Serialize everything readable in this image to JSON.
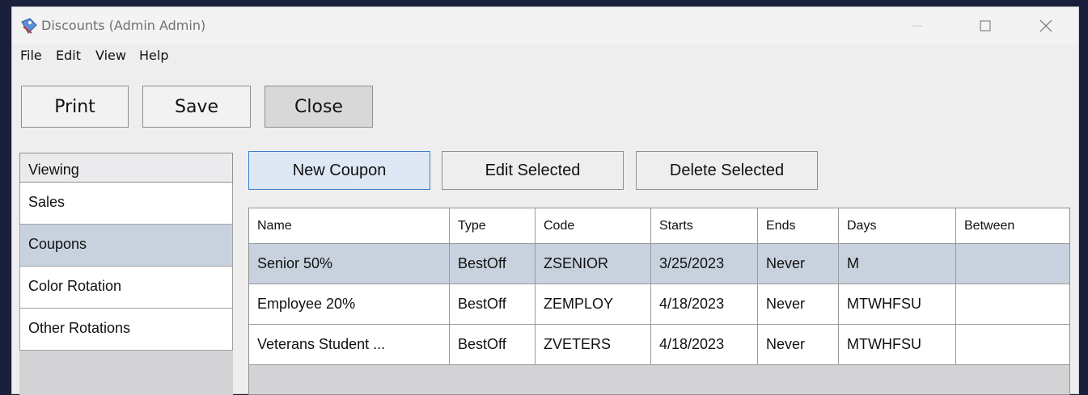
{
  "window": {
    "title": "Discounts  (Admin Admin)"
  },
  "menu": [
    "File",
    "Edit",
    "View",
    "Help"
  ],
  "toolbar": {
    "print": "Print",
    "save": "Save",
    "close": "Close"
  },
  "sidebar": {
    "header": "Viewing",
    "items": [
      "Sales",
      "Coupons",
      "Color Rotation",
      "Other Rotations"
    ],
    "selected": "Coupons"
  },
  "actions": {
    "new": "New Coupon",
    "edit": "Edit Selected",
    "delete": "Delete Selected"
  },
  "table": {
    "columns": [
      "Name",
      "Type",
      "Code",
      "Starts",
      "Ends",
      "Days",
      "Between"
    ],
    "rows": [
      [
        "Senior 50%",
        "BestOff",
        "ZSENIOR",
        "3/25/2023",
        "Never",
        "M",
        ""
      ],
      [
        "Employee 20%",
        "BestOff",
        "ZEMPLOY",
        "4/18/2023",
        "Never",
        "MTWHFSU",
        ""
      ],
      [
        "Veterans Student ...",
        "BestOff",
        "ZVETERS",
        "4/18/2023",
        "Never",
        "MTWHFSU",
        ""
      ]
    ],
    "selected_row": 0
  },
  "colors": {
    "selection": "#c7d2de",
    "focus_border": "#3c7fc8",
    "background": "#1a1f3c"
  }
}
